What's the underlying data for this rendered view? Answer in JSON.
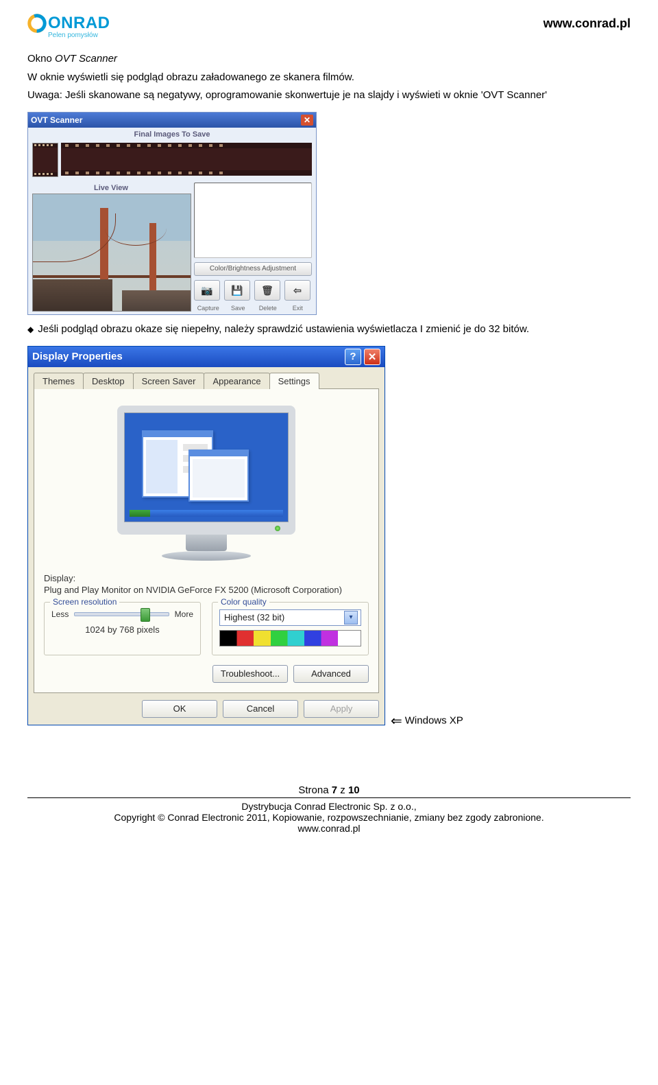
{
  "site_url": "www.conrad.pl",
  "logo": {
    "brand": "ONRAD",
    "tagline": "Pelen pomysłów"
  },
  "text": {
    "heading_okno": "Okno ",
    "heading_italic": "OVT Scanner",
    "p1": "W oknie wyświetli się podgląd obrazu załadowanego ze skanera filmów.",
    "p2": "Uwaga: Jeśli skanowane są negatywy, oprogramowanie skonwertuje je na slajdy i wyświeti w oknie 'OVT Scanner'",
    "bullet": "Jeśli podgląd obrazu okaze się niepełny, należy sprawdzić ustawienia wyświetlacza I zmienić je do 32 bitów.",
    "windows_note": "Windows XP"
  },
  "ovt": {
    "title": "OVT Scanner",
    "final_label": "Final Images To Save",
    "live_label": "Live   View",
    "adjust": "Color/Brightness Adjustment",
    "captions": [
      "Capture",
      "Save",
      "Delete",
      "Exit"
    ],
    "icons": [
      "camera-icon",
      "floppy-icon",
      "trash-icon",
      "exit-icon"
    ]
  },
  "dp": {
    "title": "Display Properties",
    "tabs": [
      "Themes",
      "Desktop",
      "Screen Saver",
      "Appearance",
      "Settings"
    ],
    "active_tab": 4,
    "display_label": "Display:",
    "display_value": "Plug and Play Monitor on NVIDIA GeForce FX 5200 (Microsoft Corporation)",
    "res_legend": "Screen resolution",
    "less": "Less",
    "more": "More",
    "res_text": "1024 by 768 pixels",
    "quality_legend": "Color quality",
    "quality_value": "Highest (32 bit)",
    "troubleshoot": "Troubleshoot...",
    "advanced": "Advanced",
    "ok": "OK",
    "cancel": "Cancel",
    "apply": "Apply"
  },
  "footer": {
    "page": "Strona ",
    "page_n": "7",
    "page_of": " z ",
    "page_total": "10",
    "l1": "Dystrybucja Conrad Electronic Sp. z o.o.,",
    "l2": "Copyright © Conrad Electronic 2011, Kopiowanie, rozpowszechnianie, zmiany bez zgody zabronione.",
    "l3": "www.conrad.pl"
  }
}
